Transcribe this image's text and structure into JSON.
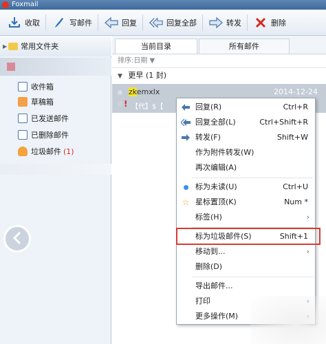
{
  "app": {
    "title": "Foxmail"
  },
  "toolbar": {
    "receive": "收取",
    "compose": "写邮件",
    "reply": "回复",
    "reply_all": "回复全部",
    "forward": "转发",
    "delete": "删除"
  },
  "sidebar": {
    "header": "常用文件夹",
    "items": [
      {
        "label": "收件箱",
        "icon": "inbox-icon"
      },
      {
        "label": "草稿箱",
        "icon": "drafts-icon"
      },
      {
        "label": "已发送邮件",
        "icon": "sent-icon"
      },
      {
        "label": "已删除邮件",
        "icon": "trash-icon"
      },
      {
        "label": "垃圾邮件",
        "icon": "junk-icon",
        "count": "(1)"
      }
    ]
  },
  "tabs": [
    "当前目录",
    "所有邮件"
  ],
  "sort": "排序:日期 ▼",
  "group": {
    "label": "更早 (1 封)"
  },
  "mail": {
    "from_hl": "zk",
    "from_rest": "emxlx",
    "date": "2014-12-24",
    "subject": "【代】$【"
  },
  "context_menu": [
    {
      "label": "回复(R)",
      "shortcut": "Ctrl+R",
      "icon": "reply-icon"
    },
    {
      "label": "回复全部(L)",
      "shortcut": "Ctrl+Shift+R",
      "icon": "reply-all-icon"
    },
    {
      "label": "转发(F)",
      "shortcut": "Shift+W",
      "icon": "forward-icon"
    },
    {
      "label": "作为附件转发(W)",
      "shortcut": ""
    },
    {
      "label": "再次编辑(A)",
      "shortcut": ""
    },
    {
      "label": "标为未读(U)",
      "shortcut": "Ctrl+U",
      "icon": "unread-dot-icon"
    },
    {
      "label": "星标置顶(K)",
      "shortcut": "Num *",
      "icon": "star-icon"
    },
    {
      "label": "标签(H)",
      "shortcut": "",
      "submenu": true
    },
    {
      "label": "标为垃圾邮件(S)",
      "shortcut": "Shift+1"
    },
    {
      "label": "移动到...",
      "shortcut": "",
      "submenu": true
    },
    {
      "label": "删除(D)",
      "shortcut": ""
    },
    {
      "label": "导出邮件...",
      "shortcut": ""
    },
    {
      "label": "打印",
      "shortcut": "",
      "submenu": true
    },
    {
      "label": "更多操作(M)",
      "shortcut": "",
      "submenu": true
    }
  ],
  "colors": {
    "highlight_border": "#d63b33",
    "selected_row": "#c4ccd6",
    "accent": "#3f6b9c"
  }
}
